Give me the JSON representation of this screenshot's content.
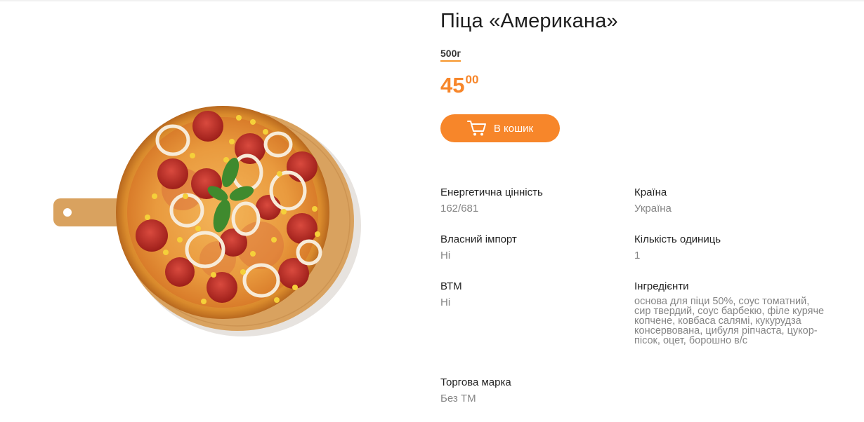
{
  "product": {
    "title": "Піца «Американа»",
    "weight": "500г",
    "price_int": "45",
    "price_frac": "00",
    "cart_button_label": "В кошик",
    "image_alt": "pizza-on-board"
  },
  "attributes": [
    {
      "label": "Енергетична цінність",
      "value": "162/681"
    },
    {
      "label": "Країна",
      "value": "Україна"
    },
    {
      "label": "Власний імпорт",
      "value": "Ні"
    },
    {
      "label": "Кількість одиниць",
      "value": "1"
    },
    {
      "label": "ВТМ",
      "value": "Ні"
    },
    {
      "label": "Інгредієнти",
      "value": "основа для піци 50%, соус томатний, сир твердий, соус барбекю, філе куряче копчене, ковбаса салямі, кукурудза консервована, цибуля ріпчаста, цукор-пісок, оцет, борошно в/с"
    },
    {
      "label": "Торгова марка",
      "value": "Без ТМ"
    }
  ],
  "colors": {
    "accent": "#f7862a",
    "muted_text": "#858585"
  },
  "icons": {
    "cart": "cart-icon"
  }
}
